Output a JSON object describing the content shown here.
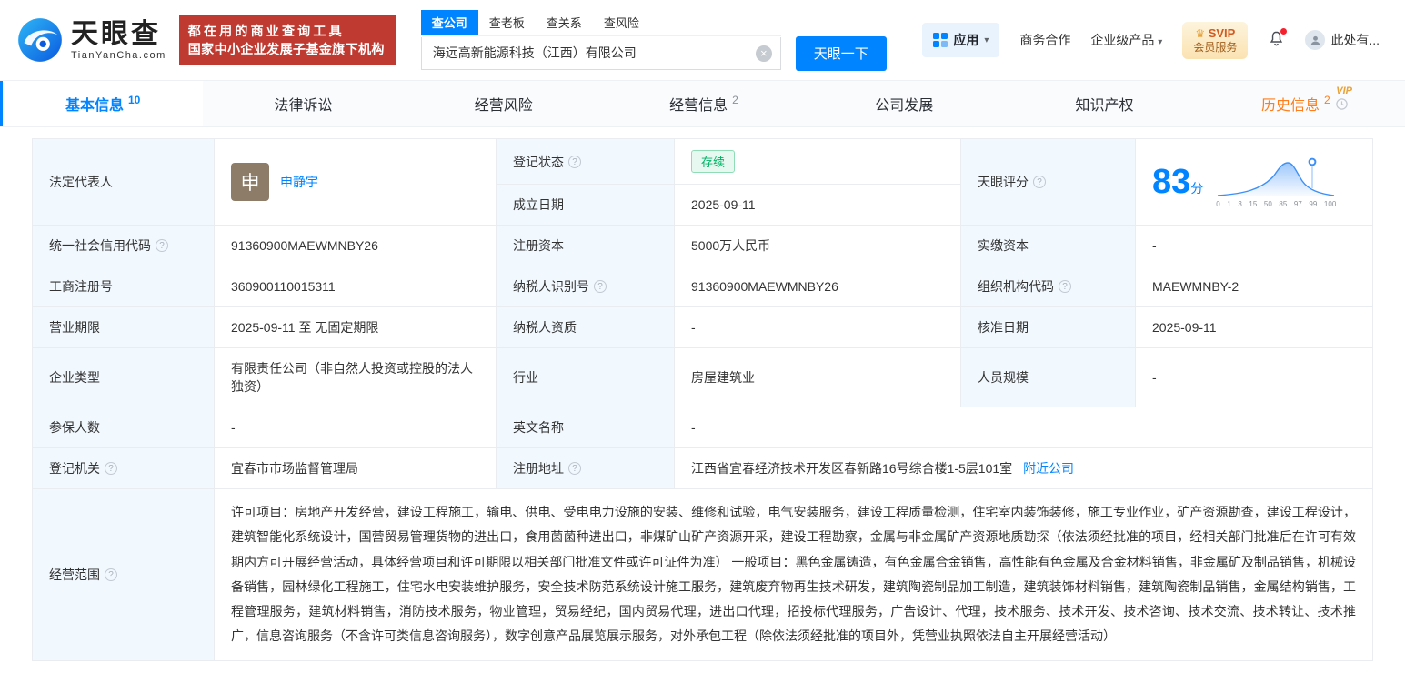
{
  "icons": {
    "help": "?",
    "clear": "×",
    "caret": "▾",
    "crown": "♛"
  },
  "brand": {
    "logo_cn": "天眼查",
    "logo_en": "TianYanCha.com",
    "banner_line1": "都在用的商业查询工具",
    "banner_line2": "国家中小企业发展子基金旗下机构"
  },
  "search": {
    "tabs": [
      {
        "label": "查公司",
        "active": true
      },
      {
        "label": "查老板"
      },
      {
        "label": "查关系"
      },
      {
        "label": "查风险"
      }
    ],
    "value": "海远高新能源科技（江西）有限公司",
    "button": "天眼一下"
  },
  "header_right": {
    "apps": "应用",
    "cooperation": "商务合作",
    "enterprise": "企业级产品",
    "svip_line1": "SVIP",
    "svip_line2": "会员服务",
    "user": "此处有..."
  },
  "nav": {
    "tabs": [
      {
        "label": "基本信息",
        "count": "10",
        "active": true
      },
      {
        "label": "法律诉讼"
      },
      {
        "label": "经营风险"
      },
      {
        "label": "经营信息",
        "count": "2"
      },
      {
        "label": "公司发展"
      },
      {
        "label": "知识产权"
      },
      {
        "label": "历史信息",
        "count": "2",
        "vip": "VIP"
      }
    ]
  },
  "score": {
    "label": "天眼评分",
    "value": "83",
    "unit": "分",
    "ticks": [
      "0",
      "1",
      "3",
      "15",
      "50",
      "85",
      "97",
      "99",
      "100"
    ]
  },
  "table": {
    "legal_rep": {
      "label": "法定代表人",
      "avatar": "申",
      "name": "申静宇"
    },
    "reg_status": {
      "label": "登记状态",
      "value": "存续"
    },
    "establish_date": {
      "label": "成立日期",
      "value": "2025-09-11"
    },
    "credit_code": {
      "label": "统一社会信用代码",
      "value": "91360900MAEWMNBY26"
    },
    "reg_capital": {
      "label": "注册资本",
      "value": "5000万人民币"
    },
    "paid_capital": {
      "label": "实缴资本",
      "value": "-"
    },
    "reg_number": {
      "label": "工商注册号",
      "value": "360900110015311"
    },
    "taxpayer_id": {
      "label": "纳税人识别号",
      "value": "91360900MAEWMNBY26"
    },
    "org_code": {
      "label": "组织机构代码",
      "value": "MAEWMNBY-2"
    },
    "business_term": {
      "label": "营业期限",
      "value": "2025-09-11 至 无固定期限"
    },
    "taxpayer_quality": {
      "label": "纳税人资质",
      "value": "-"
    },
    "approval_date": {
      "label": "核准日期",
      "value": "2025-09-11"
    },
    "company_type": {
      "label": "企业类型",
      "value": "有限责任公司（非自然人投资或控股的法人独资）"
    },
    "industry": {
      "label": "行业",
      "value": "房屋建筑业"
    },
    "staff_size": {
      "label": "人员规模",
      "value": "-"
    },
    "insured_count": {
      "label": "参保人数",
      "value": "-"
    },
    "english_name": {
      "label": "英文名称",
      "value": "-"
    },
    "reg_authority": {
      "label": "登记机关",
      "value": "宜春市市场监督管理局"
    },
    "reg_address": {
      "label": "注册地址",
      "value": "江西省宜春经济技术开发区春新路16号综合楼1-5层101室",
      "link": "附近公司"
    },
    "business_scope": {
      "label": "经营范围",
      "value": "许可项目：房地产开发经营，建设工程施工，输电、供电、受电电力设施的安装、维修和试验，电气安装服务，建设工程质量检测，住宅室内装饰装修，施工专业作业，矿产资源勘查，建设工程设计，建筑智能化系统设计，国营贸易管理货物的进出口，食用菌菌种进出口，非煤矿山矿产资源开采，建设工程勘察，金属与非金属矿产资源地质勘探（依法须经批准的项目，经相关部门批准后在许可有效期内方可开展经营活动，具体经营项目和许可期限以相关部门批准文件或许可证件为准） 一般项目：黑色金属铸造，有色金属合金销售，高性能有色金属及合金材料销售，非金属矿及制品销售，机械设备销售，园林绿化工程施工，住宅水电安装维护服务，安全技术防范系统设计施工服务，建筑废弃物再生技术研发，建筑陶瓷制品加工制造，建筑装饰材料销售，建筑陶瓷制品销售，金属结构销售，工程管理服务，建筑材料销售，消防技术服务，物业管理，贸易经纪，国内贸易代理，进出口代理，招投标代理服务，广告设计、代理，技术服务、技术开发、技术咨询、技术交流、技术转让、技术推广，信息咨询服务（不含许可类信息咨询服务），数字创意产品展览展示服务，对外承包工程（除依法须经批准的项目外，凭营业执照依法自主开展经营活动）"
    }
  }
}
